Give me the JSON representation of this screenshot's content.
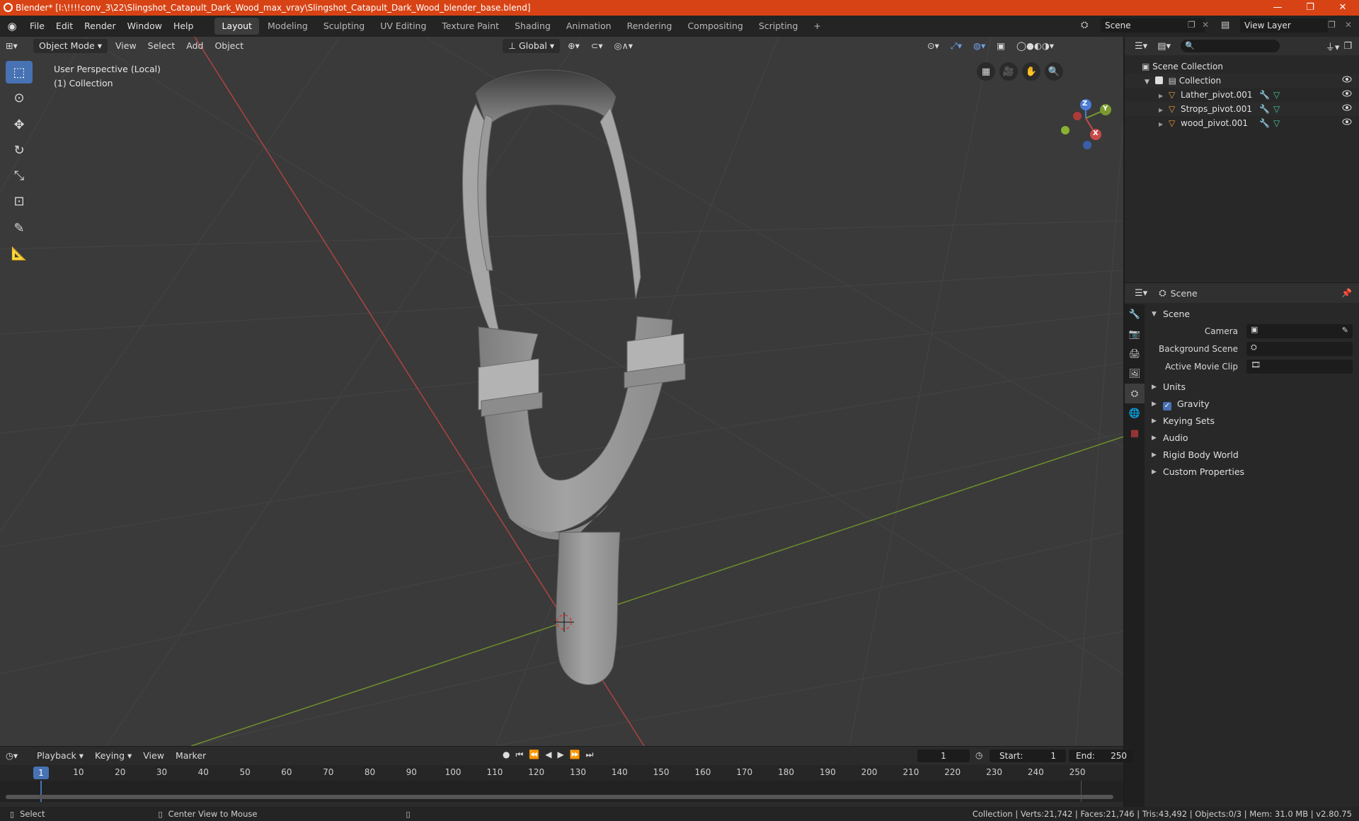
{
  "window": {
    "title": "Blender* [I:\\!!!!conv_3\\22\\Slingshot_Catapult_Dark_Wood_max_vray\\Slingshot_Catapult_Dark_Wood_blender_base.blend]",
    "minimize": "—",
    "maximize": "❐",
    "close": "✕"
  },
  "menus": [
    "File",
    "Edit",
    "Render",
    "Window",
    "Help"
  ],
  "workspaces": [
    "Layout",
    "Modeling",
    "Sculpting",
    "UV Editing",
    "Texture Paint",
    "Shading",
    "Animation",
    "Rendering",
    "Compositing",
    "Scripting"
  ],
  "active_workspace": "Layout",
  "scene_name": "Scene",
  "view_layer": "View Layer",
  "viewport": {
    "mode": "Object Mode",
    "menus": [
      "View",
      "Select",
      "Add",
      "Object"
    ],
    "orientation": "Global",
    "info_line1": "User Perspective (Local)",
    "info_line2": "(1) Collection",
    "gizmo_axes": {
      "z": "Z",
      "y": "Y",
      "x": "X"
    }
  },
  "outliner": {
    "root": "Scene Collection",
    "collection": "Collection",
    "objects": [
      "Lather_pivot.001",
      "Strops_pivot.001",
      "wood_pivot.001"
    ]
  },
  "properties": {
    "header": "Scene",
    "section": "Scene",
    "fields": [
      {
        "label": "Camera",
        "value": ""
      },
      {
        "label": "Background Scene",
        "value": ""
      },
      {
        "label": "Active Movie Clip",
        "value": ""
      }
    ],
    "panels": [
      "Units",
      "Gravity",
      "Keying Sets",
      "Audio",
      "Rigid Body World",
      "Custom Properties"
    ],
    "gravity_checked": true
  },
  "timeline": {
    "menus": [
      "Playback",
      "Keying",
      "View",
      "Marker"
    ],
    "current_frame": "1",
    "start_label": "Start:",
    "start": "1",
    "end_label": "End:",
    "end": "250",
    "ticks": [
      "10",
      "20",
      "30",
      "40",
      "50",
      "60",
      "70",
      "80",
      "90",
      "100",
      "110",
      "120",
      "130",
      "140",
      "150",
      "160",
      "170",
      "180",
      "190",
      "200",
      "210",
      "220",
      "230",
      "240",
      "250"
    ],
    "current_marker": "1"
  },
  "status": {
    "left": "Select",
    "middle": "Center View to Mouse",
    "right": "Collection | Verts:21,742 | Faces:21,746 | Tris:43,492 | Objects:0/3 | Mem: 31.0 MB | v2.80.75"
  },
  "colors": {
    "titlebar": "#d84315",
    "accent": "#4772b3",
    "x_axis": "#c84a4a",
    "y_axis": "#7a9a2f",
    "z_axis": "#4a7bd6"
  }
}
